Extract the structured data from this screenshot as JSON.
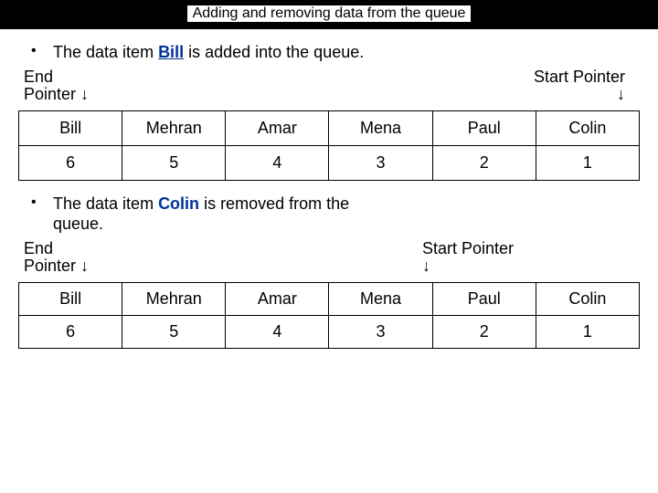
{
  "title": "Adding and removing data from the queue",
  "section1": {
    "bullet_pre": "The data item ",
    "bullet_kw": "Bill",
    "bullet_post": " is added into the queue.",
    "end_label_l1": "End",
    "end_label_l2": "Pointer ↓",
    "start_label_l1": "Start Pointer",
    "start_label_l2": "↓",
    "names": [
      "Bill",
      "Mehran",
      "Amar",
      "Mena",
      "Paul",
      "Colin"
    ],
    "nums": [
      "6",
      "5",
      "4",
      "3",
      "2",
      "1"
    ]
  },
  "section2": {
    "bullet_pre": "The data item ",
    "bullet_kw": "Colin",
    "bullet_post": " is removed from the queue.",
    "end_label_l1": "End",
    "end_label_l2": "Pointer ↓",
    "start_label_l1": "Start Pointer",
    "start_label_l2": "↓",
    "names": [
      "Bill",
      "Mehran",
      "Amar",
      "Mena",
      "Paul",
      "Colin"
    ],
    "nums": [
      "6",
      "5",
      "4",
      "3",
      "2",
      "1"
    ]
  }
}
